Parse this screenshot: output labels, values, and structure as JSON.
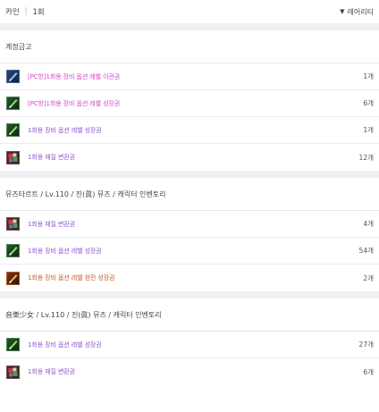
{
  "header": {
    "character": "카인",
    "separator": "|",
    "period": "1회",
    "sort_label": "레어리티"
  },
  "sections": [
    {
      "title": "계정금고",
      "items": [
        {
          "name": "[PC방]1회용 장비 옵션 레벨 이관권",
          "count": "1개",
          "color": "#d444c8",
          "icon": "blue-scroll-icon"
        },
        {
          "name": "[PC방]1회용 장비 옵션 레벨 성장권",
          "count": "6개",
          "color": "#d444c8",
          "icon": "green-scroll-icon"
        },
        {
          "name": "1회용 장비 옵션 레벨 성장권",
          "count": "1개",
          "color": "#8a55d0",
          "icon": "green-scroll-icon"
        },
        {
          "name": "1회용 재질 변환권",
          "count": "12개",
          "color": "#8a55d0",
          "icon": "material-box-icon"
        }
      ]
    },
    {
      "title": "뮤즈타르트 / Lv.110 / 진(眞) 뮤즈 / 캐릭터 인벤토리",
      "items": [
        {
          "name": "1회용 재질 변환권",
          "count": "4개",
          "color": "#8a55d0",
          "icon": "material-box-icon"
        },
        {
          "name": "1회용 장비 옵션 레벨 성장권",
          "count": "54개",
          "color": "#8a55d0",
          "icon": "green-scroll-icon"
        },
        {
          "name": "1회용 장비 옵션 레벨 완전 성장권",
          "count": "2개",
          "color": "#c95a28",
          "icon": "orange-scroll-icon"
        }
      ]
    },
    {
      "title": "音樂少女 / Lv.110 / 진(眞) 뮤즈 / 캐릭터 인벤토리",
      "items": [
        {
          "name": "1회용 장비 옵션 레벨 성장권",
          "count": "27개",
          "color": "#8a55d0",
          "icon": "green-scroll-icon"
        },
        {
          "name": "1회용 재질 변환권",
          "count": "6개",
          "color": "#8a55d0",
          "icon": "material-box-icon"
        }
      ]
    }
  ]
}
